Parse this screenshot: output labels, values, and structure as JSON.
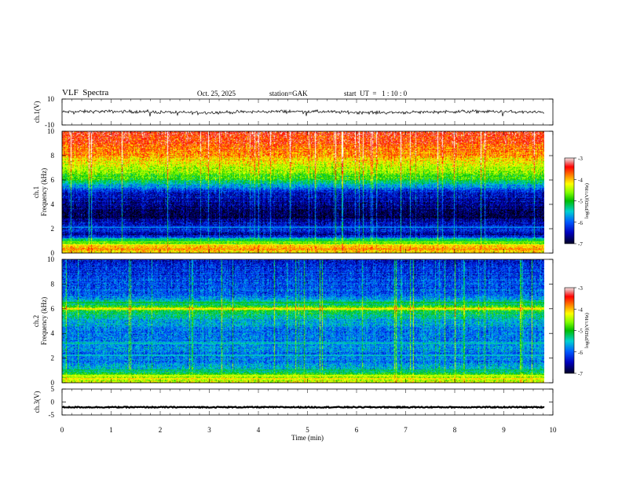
{
  "header": {
    "title": "VLF  Spectra",
    "date": "Oct. 25, 2025",
    "station": "station=GAK",
    "start_ut": "start  UT  =   1 : 10 : 0"
  },
  "chart_data": [
    {
      "type": "line",
      "panel": "ch1-waveform",
      "ylabel": "ch.1(V)",
      "ylim": [
        -10,
        10
      ],
      "yticks": [
        "10",
        "-10"
      ],
      "xlim": [
        0,
        10
      ],
      "data_extent_min": 9.82,
      "baseline_v": 0,
      "noise_amplitude_v": 3
    },
    {
      "type": "heatmap",
      "panel": "ch1-spectrogram",
      "ylabel": "ch.1\nFrequency (kHz)",
      "ylim": [
        0,
        10
      ],
      "yticks": [
        "0",
        "2",
        "4",
        "6",
        "8",
        "10"
      ],
      "xlim": [
        0,
        10
      ],
      "data_extent_min": 9.82,
      "colorbar": {
        "label": "log(PSD)(V²/Hz)",
        "range": [
          -7,
          -3
        ],
        "ticks": [
          "-3",
          "-4",
          "-5",
          "-6",
          "-7"
        ]
      },
      "profile_khz": [
        [
          0,
          -4.2
        ],
        [
          0.5,
          -4.0
        ],
        [
          1.0,
          -5.3
        ],
        [
          1.5,
          -6.6
        ],
        [
          2.0,
          -6.2
        ],
        [
          3.0,
          -6.9
        ],
        [
          4.0,
          -6.7
        ],
        [
          5.0,
          -6.3
        ],
        [
          5.6,
          -5.6
        ],
        [
          6.0,
          -5.0
        ],
        [
          7.0,
          -4.4
        ],
        [
          8.0,
          -3.9
        ],
        [
          9.0,
          -3.6
        ],
        [
          10.0,
          -3.4
        ]
      ],
      "lines_khz": [
        [
          0.3,
          -3.8
        ],
        [
          0.6,
          -4.0
        ],
        [
          0.9,
          -4.6
        ],
        [
          1.1,
          -5.2
        ],
        [
          2.1,
          -5.6
        ],
        [
          5.8,
          -5.4
        ]
      ]
    },
    {
      "type": "heatmap",
      "panel": "ch2-spectrogram",
      "ylabel": "ch.2\nFrequency (kHz)",
      "ylim": [
        0,
        10
      ],
      "yticks": [
        "0",
        "2",
        "4",
        "6",
        "8",
        "10"
      ],
      "xlim": [
        0,
        10
      ],
      "data_extent_min": 9.82,
      "colorbar": {
        "label": "log(PSD)(V²/Hz)",
        "range": [
          -7,
          -3
        ],
        "ticks": [
          "-3",
          "-4",
          "-5",
          "-6",
          "-7"
        ]
      },
      "profile_khz": [
        [
          0,
          -4.4
        ],
        [
          0.5,
          -4.6
        ],
        [
          1.0,
          -5.6
        ],
        [
          2.0,
          -5.9
        ],
        [
          3.0,
          -5.8
        ],
        [
          4.0,
          -5.9
        ],
        [
          5.0,
          -5.6
        ],
        [
          5.8,
          -5.1
        ],
        [
          6.0,
          -4.3
        ],
        [
          6.3,
          -5.2
        ],
        [
          7.0,
          -5.9
        ],
        [
          8.0,
          -6.1
        ],
        [
          9.0,
          -6.2
        ],
        [
          10.0,
          -6.3
        ]
      ],
      "lines_khz": [
        [
          0.3,
          -3.9
        ],
        [
          0.55,
          -4.2
        ],
        [
          1.0,
          -5.0
        ],
        [
          2.2,
          -5.4
        ],
        [
          3.2,
          -5.3
        ],
        [
          6.0,
          -4.0
        ],
        [
          6.5,
          -4.8
        ]
      ]
    },
    {
      "type": "line",
      "panel": "ch3-waveform",
      "ylabel": "ch.3(V)",
      "ylim": [
        -5,
        5
      ],
      "yticks": [
        "5",
        "0",
        "-5"
      ],
      "xlim": [
        0,
        10
      ],
      "data_extent_min": 9.82,
      "baseline_v": -2,
      "noise_amplitude_v": 0.4
    }
  ],
  "x_axis": {
    "xlabel": "Time  (min)",
    "ticks": [
      "0",
      "1",
      "2",
      "3",
      "4",
      "5",
      "6",
      "7",
      "8",
      "9",
      "10"
    ]
  },
  "colorscale": [
    "#ffffff",
    "#e8b0b0",
    "#ff0000",
    "#ff8000",
    "#ffff00",
    "#80ff00",
    "#00c000",
    "#00d0d0",
    "#0060ff",
    "#0000c0",
    "#000040",
    "#000000"
  ]
}
